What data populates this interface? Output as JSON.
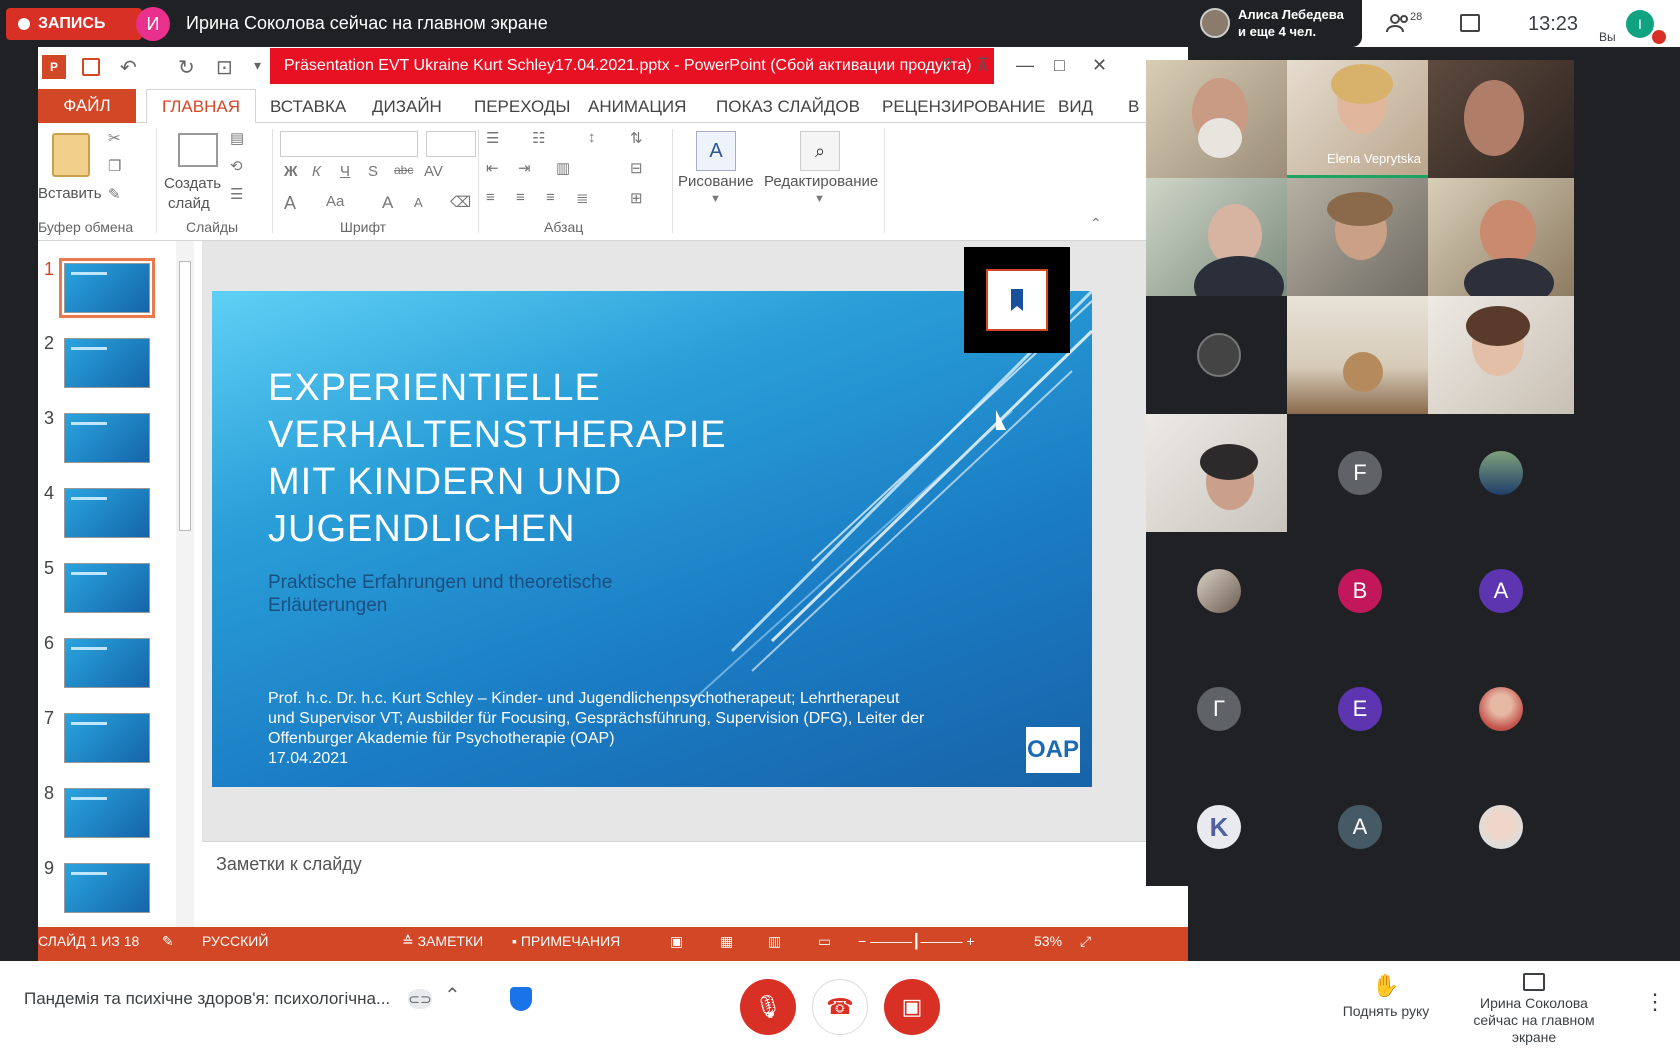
{
  "topbar": {
    "record_label": "ЗАПИСЬ",
    "presenter_initial": "И",
    "presenter_text": "Ирина Соколова сейчас на главном экране",
    "alice_line1": "Алиса Лебедева",
    "alice_line2": "и еще 4 чел.",
    "people_count": "28",
    "clock": "13:23",
    "you_label": "Вы",
    "you_initial": "I"
  },
  "ppt": {
    "title": "Präsentation EVT Ukraine  Kurt Schley17.04.2021.pptx  -  PowerPoint (Сбой активации продукта)",
    "help": "?",
    "tabs": {
      "file": "ФАЙЛ",
      "home": "ГЛАВНАЯ",
      "insert": "ВСТАВКА",
      "design": "ДИЗАЙН",
      "transitions": "ПЕРЕХОДЫ",
      "animation": "АНИМАЦИЯ",
      "slideshow": "ПОКАЗ СЛАЙДОВ",
      "review": "РЕЦЕНЗИРОВАНИЕ",
      "view": "ВИД",
      "more": "В"
    },
    "ribbon": {
      "paste": "Вставить",
      "clipboard_group": "Буфер обмена",
      "new_slide_1": "Создать",
      "new_slide_2": "слайд",
      "slides_group": "Слайды",
      "font_group": "Шрифт",
      "paragraph_group": "Абзац",
      "drawing": "Рисование",
      "editing": "Редактирование",
      "bold": "Ж",
      "italic": "К",
      "underline": "Ч",
      "shadow": "S",
      "strike": "abc",
      "spacing": "AV",
      "font_a": "A",
      "case": "Aa",
      "grow": "A",
      "shrink": "A"
    },
    "thumbnails": [
      "1",
      "2",
      "3",
      "4",
      "5",
      "6",
      "7",
      "8",
      "9"
    ],
    "slide": {
      "title_lines": [
        "EXPERIENTIELLE",
        "VERHALTENSTHERAPIE",
        "MIT KINDERN UND",
        "JUGENDLICHEN"
      ],
      "subtitle_lines": [
        "Praktische Erfahrungen und theoretische",
        "Erläuterungen"
      ],
      "body_lines": [
        "Prof. h.c. Dr. h.c. Kurt Schley – Kinder- und Jugendlichenpsychotherapeut; Lehrtherapeut",
        "und Supervisor VT; Ausbilder für Focusing, Gesprächsführung, Supervision (DFG), Leiter der",
        "Offenburger Akademie für Psychotherapie (OAP)",
        "17.04.2021"
      ],
      "logo": "OAP"
    },
    "notes_placeholder": "Заметки к слайду",
    "status": {
      "slide_of": "СЛАЙД 1 ИЗ 18",
      "language": "РУССКИЙ",
      "notes": "ЗАМЕТКИ",
      "comments": "ПРИМЕЧАНИЯ",
      "zoom": "53%"
    }
  },
  "participants": {
    "speaking_name": "Elena Veprytska",
    "tiles": [
      {
        "type": "letter",
        "letter": "F",
        "color": "#5f6368"
      },
      {
        "type": "letter",
        "letter": "В",
        "color": "#c2185b"
      },
      {
        "type": "letter",
        "letter": "A",
        "color": "#5e35b1"
      },
      {
        "type": "letter",
        "letter": "Г",
        "color": "#5f6368"
      },
      {
        "type": "letter",
        "letter": "E",
        "color": "#5e35b1"
      },
      {
        "type": "letter",
        "letter": "A",
        "color": "#455a64"
      }
    ]
  },
  "bottom": {
    "meeting_name": "Пандемія та психічне здоров'я: психологічна...",
    "raise_hand": "Поднять руку",
    "presenting_line1": "Ирина Соколова",
    "presenting_line2": "сейчас на главном экране"
  }
}
